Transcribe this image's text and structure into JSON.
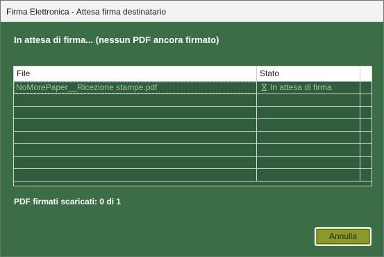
{
  "window": {
    "title": "Firma Elettronica - Attesa firma destinatario"
  },
  "heading": "In attesa di firma... (nessun PDF ancora firmato)",
  "grid": {
    "columns": [
      "File",
      "Stato",
      ""
    ],
    "rows": [
      {
        "file": "NoMorePaper__Ricezione stampe.pdf",
        "stato": "In attesa di firma",
        "icon": "hourglass-icon"
      },
      {
        "file": "",
        "stato": ""
      },
      {
        "file": "",
        "stato": ""
      },
      {
        "file": "",
        "stato": ""
      },
      {
        "file": "",
        "stato": ""
      },
      {
        "file": "",
        "stato": ""
      },
      {
        "file": "",
        "stato": ""
      },
      {
        "file": "",
        "stato": ""
      }
    ]
  },
  "status": {
    "downloaded_text": "PDF firmati scaricati: 0 di 1"
  },
  "buttons": {
    "cancel_label": "Annulla"
  },
  "colors": {
    "background": "#3b6e47",
    "grid_background": "#2f5d3e",
    "muted_text": "#9fc29f",
    "button": "#8a9a2a"
  }
}
